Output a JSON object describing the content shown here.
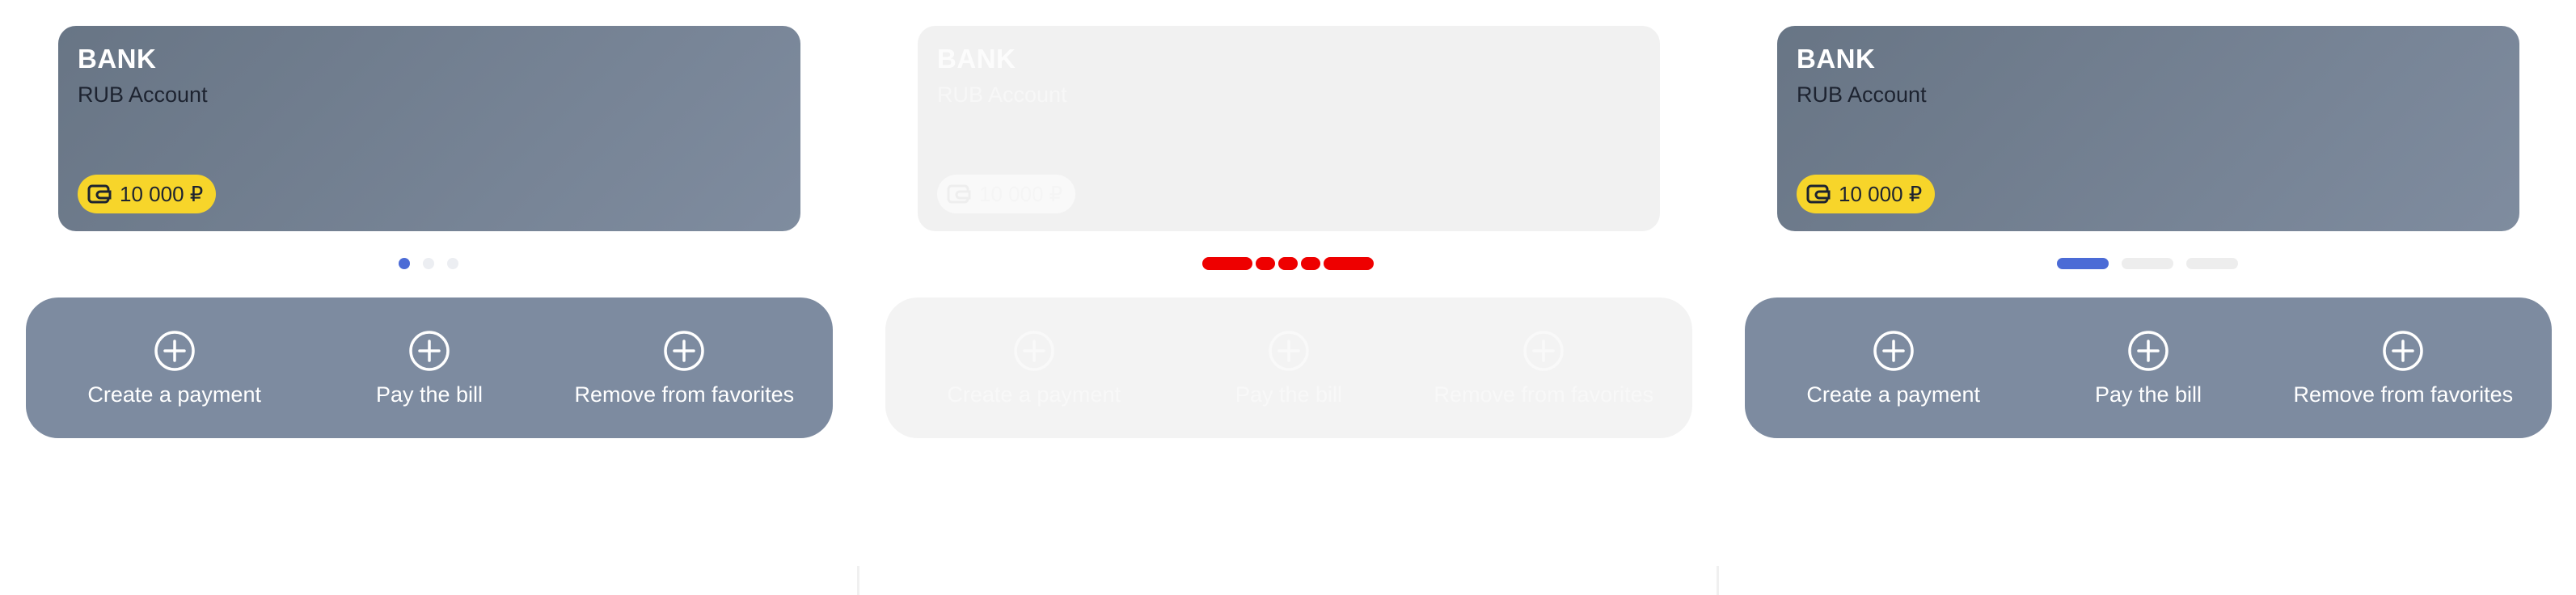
{
  "cards": [
    {
      "bank": "BANK",
      "account": "RUB Account",
      "balance": "10 000 ₽",
      "pager": {
        "style": "dots",
        "count": 3,
        "active": 0
      },
      "actions": [
        {
          "label": "Create a payment",
          "icon": "plus-circle-icon"
        },
        {
          "label": "Pay the bill",
          "icon": "plus-circle-icon"
        },
        {
          "label": "Remove from favorites",
          "icon": "plus-circle-icon"
        }
      ]
    },
    {
      "bank": "BANK",
      "account": "RUB Account",
      "balance": "10 000 ₽",
      "state": "disabled",
      "pager": {
        "style": "red-bars",
        "count": 3
      },
      "actions": [
        {
          "label": "Create a payment",
          "icon": "plus-circle-icon"
        },
        {
          "label": "Pay the bill",
          "icon": "plus-circle-icon"
        },
        {
          "label": "Remove from favorites",
          "icon": "plus-circle-icon"
        }
      ]
    },
    {
      "bank": "BANK",
      "account": "RUB Account",
      "balance": "10 000 ₽",
      "pager": {
        "style": "bars",
        "count": 3,
        "active": 0
      },
      "actions": [
        {
          "label": "Create a payment",
          "icon": "plus-circle-icon"
        },
        {
          "label": "Pay the bill",
          "icon": "plus-circle-icon"
        },
        {
          "label": "Remove from favorites",
          "icon": "plus-circle-icon"
        }
      ]
    }
  ],
  "colors": {
    "card": "#7a879a",
    "chip": "#f7d52a",
    "accent": "#4b6bd6",
    "pager_red": "#ee0000",
    "actions_bg": "#7d8ba0"
  }
}
